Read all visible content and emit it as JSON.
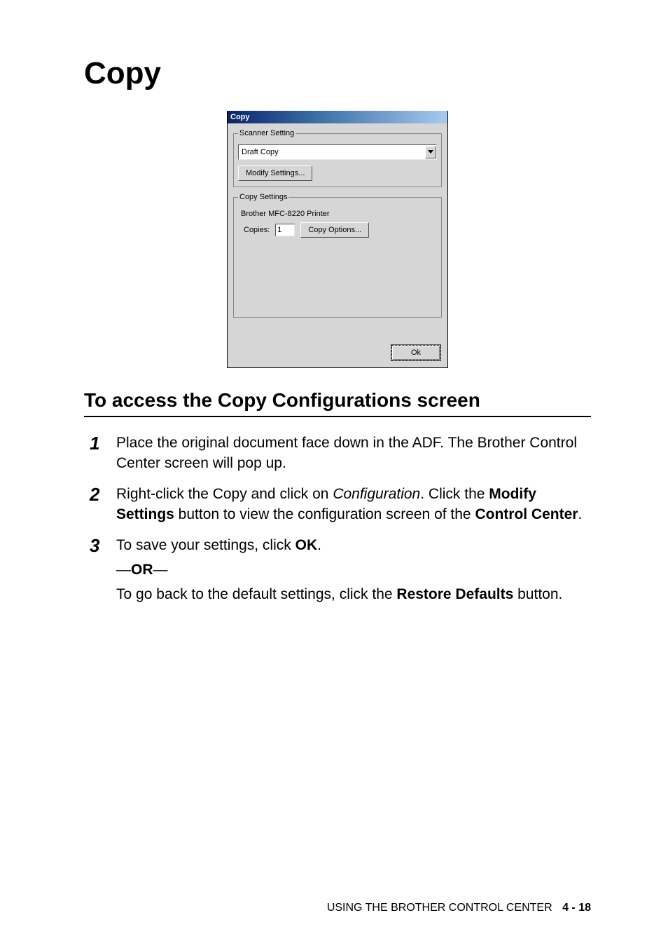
{
  "heading": "Copy",
  "dialog": {
    "title": "Copy",
    "scanner_setting_legend": "Scanner Setting",
    "scanner_combo_value": "Draft Copy",
    "modify_settings_label": "Modify Settings...",
    "copy_settings_legend": "Copy Settings",
    "printer_name": "Brother MFC-8220 Printer",
    "copies_label": "Copies:",
    "copies_value": "1",
    "copy_options_label": "Copy Options...",
    "ok_label": "Ok"
  },
  "subheading": "To access the Copy Configurations screen",
  "steps": {
    "s1": {
      "num": "1",
      "text": "Place the original document face down in the ADF. The Brother Control Center screen will pop up."
    },
    "s2": {
      "num": "2",
      "pre": "Right-click the Copy and click on ",
      "conf": "Configuration",
      "mid1": ". Click the ",
      "mod": "Modify Settings",
      "mid2": " button to view the configuration screen of the ",
      "cc": "Control Center",
      "post": "."
    },
    "s3": {
      "num": "3",
      "line1a": "To save your settings, click ",
      "ok": "OK",
      "line1b": ".",
      "or_pre": "—",
      "or": "OR",
      "or_post": "—",
      "line2a": "To go back to the default settings, click the ",
      "rd": "Restore Defaults",
      "line2b": " button."
    }
  },
  "footer": {
    "text": "USING THE BROTHER CONTROL CENTER",
    "section": "4 - 18"
  }
}
